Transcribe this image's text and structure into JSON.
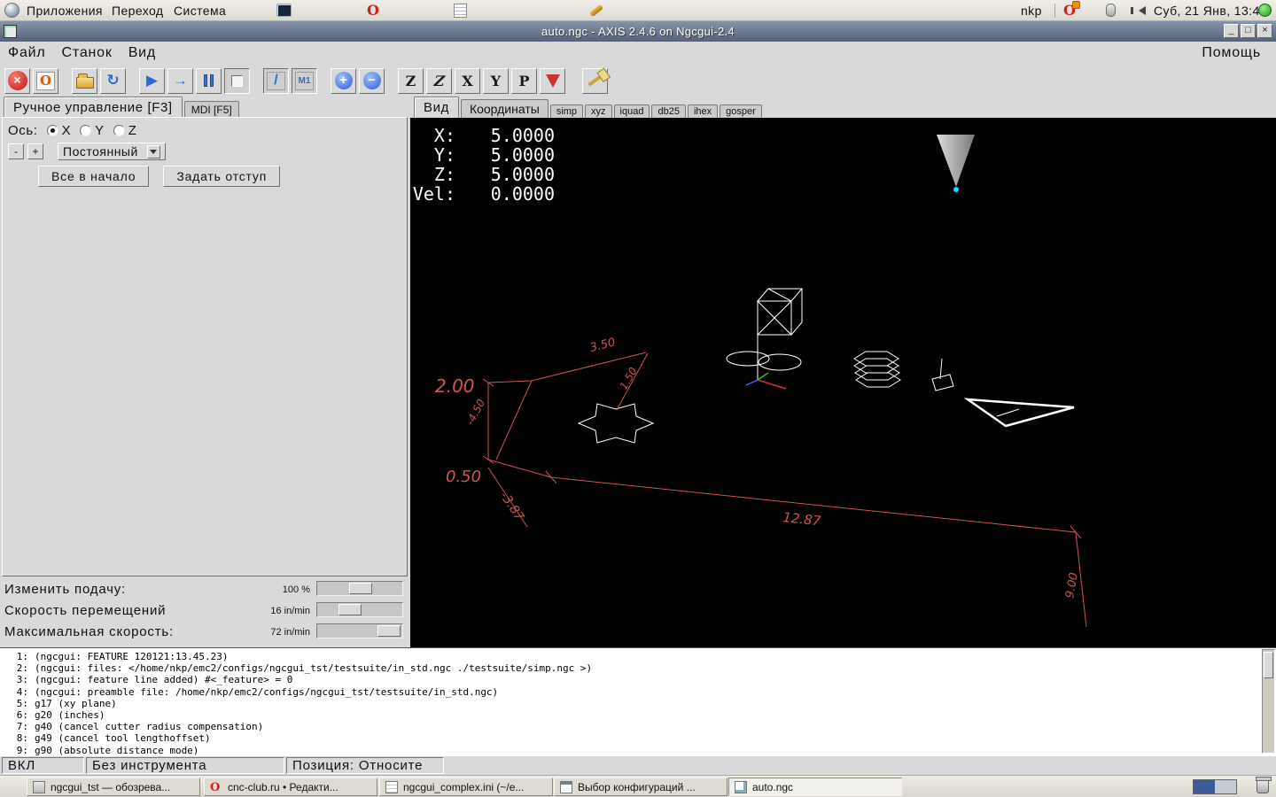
{
  "glyphs": {
    "opera": "O"
  },
  "desktop": {
    "menus": [
      "Приложения",
      "Переход",
      "Система"
    ],
    "user": "nkp",
    "clock": "Суб, 21 Янв, 13:45"
  },
  "window": {
    "title": "auto.ngc - AXIS 2.4.6 on Ngcgui-2.4",
    "controls": {
      "min": "_",
      "max": "□",
      "close": "×"
    },
    "menus": [
      "Файл",
      "Станок",
      "Вид"
    ],
    "help": "Помощь"
  },
  "toolbar": {
    "glyphs": {
      "estop": "×",
      "power": "O",
      "reload": "↻",
      "run": "▶",
      "step": "→",
      "block_delete": "/",
      "optional_stop": "M1",
      "zoom_in": "+",
      "zoom_out": "−",
      "view_top": "Z",
      "view_rot": "Z",
      "view_side": "X",
      "view_front": "Y",
      "view_persp": "P"
    }
  },
  "manual": {
    "tabs": [
      "Ручное управление [F3]",
      "MDI [F5]"
    ],
    "axis_label": "Ось:",
    "axes": [
      "X",
      "Y",
      "Z"
    ],
    "jog_minus": "-",
    "jog_plus": "+",
    "jog_mode": "Постоянный",
    "home_all": "Все в начало",
    "touch_off": "Задать отступ"
  },
  "feed": {
    "rows": [
      {
        "label": "Изменить подачу:",
        "value": "100 %"
      },
      {
        "label": "Скорость перемещений",
        "value": "16 in/min"
      },
      {
        "label": "Максимальная скорость:",
        "value": "72 in/min"
      }
    ]
  },
  "preview": {
    "tabs": [
      "Вид",
      "Координаты"
    ],
    "file_tabs": [
      "simp",
      "xyz",
      "iquad",
      "db25",
      "ihex",
      "gosper"
    ],
    "dro": [
      {
        "label": "X:",
        "value": "5.0000"
      },
      {
        "label": "Y:",
        "value": "5.0000"
      },
      {
        "label": "Z:",
        "value": "5.0000"
      },
      {
        "label": "Vel:",
        "value": "0.0000"
      }
    ],
    "dims": [
      "2.00",
      "0.50",
      "3.50",
      "1.50",
      "-4.50",
      "-3.87",
      "12.87",
      "9.00"
    ]
  },
  "gcode": {
    "lines": [
      {
        "num": "1:",
        "text": "(ngcgui: FEATURE 120121:13.45.23)"
      },
      {
        "num": "2:",
        "text": "(ngcgui: files: </home/nkp/emc2/configs/ngcgui_tst/testsuite/in_std.ngc ./testsuite/simp.ngc >)"
      },
      {
        "num": "3:",
        "text": "(ngcgui: feature line added) #<_feature> = 0"
      },
      {
        "num": "4:",
        "text": "(ngcgui: preamble file: /home/nkp/emc2/configs/ngcgui_tst/testsuite/in_std.ngc)"
      },
      {
        "num": "5:",
        "text": "g17 (xy plane)"
      },
      {
        "num": "6:",
        "text": "g20 (inches)"
      },
      {
        "num": "7:",
        "text": "g40 (cancel cutter radius compensation)"
      },
      {
        "num": "8:",
        "text": "g49 (cancel tool lengthoffset)"
      },
      {
        "num": "9:",
        "text": "g90 (absolute distance mode)"
      }
    ]
  },
  "status": {
    "cells": [
      "ВКЛ",
      "Без инструмента",
      "Позиция: Относите"
    ]
  },
  "taskbar": {
    "items": [
      {
        "label": "ngcgui_tst — обозрева..."
      },
      {
        "label": "cnc-club.ru • Редакти..."
      },
      {
        "label": "ngcgui_complex.ini (~/e..."
      },
      {
        "label": "Выбор конфигураций ..."
      },
      {
        "label": "auto.ngc"
      }
    ]
  }
}
